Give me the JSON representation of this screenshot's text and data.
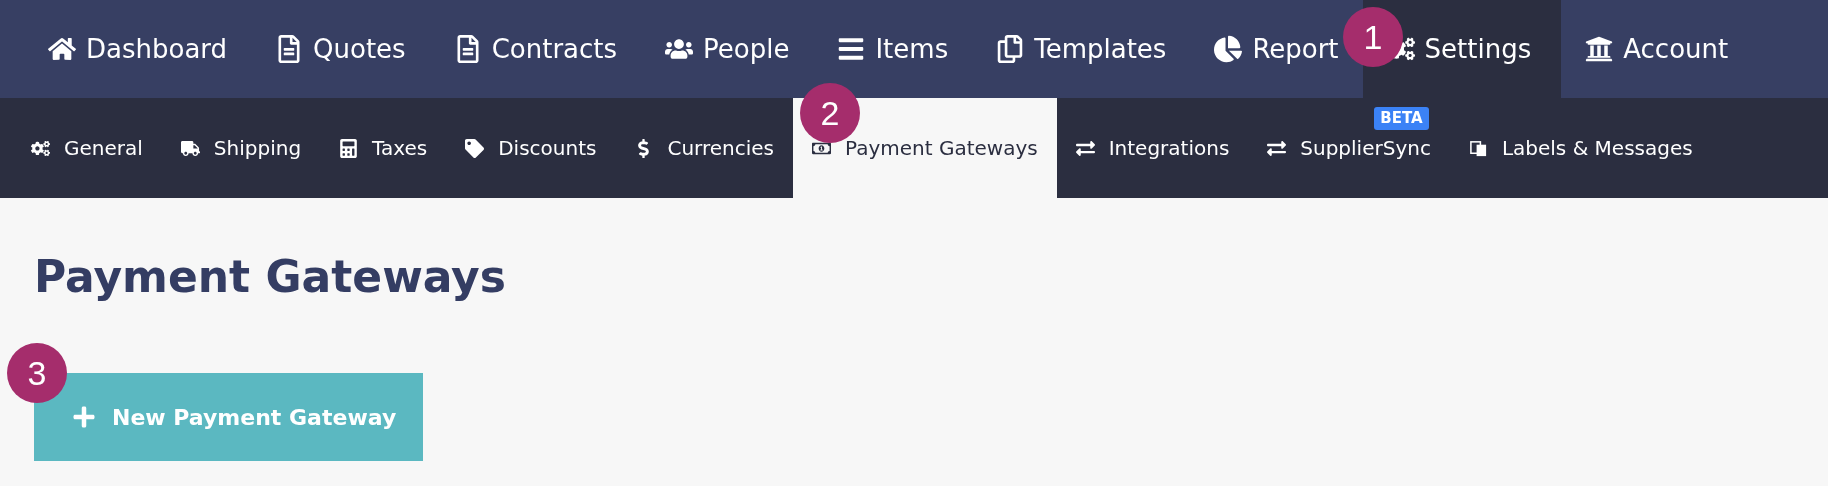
{
  "main_nav": [
    {
      "label": "Dashboard",
      "selected": false
    },
    {
      "label": "Quotes",
      "selected": false
    },
    {
      "label": "Contracts",
      "selected": false
    },
    {
      "label": "People",
      "selected": false
    },
    {
      "label": "Items",
      "selected": false
    },
    {
      "label": "Templates",
      "selected": false
    },
    {
      "label": "Report",
      "selected": false
    },
    {
      "label": "Settings",
      "selected": true
    },
    {
      "label": "Account",
      "selected": false
    }
  ],
  "settings_nav": [
    {
      "label": "General",
      "selected": false
    },
    {
      "label": "Shipping",
      "selected": false
    },
    {
      "label": "Taxes",
      "selected": false
    },
    {
      "label": "Discounts",
      "selected": false
    },
    {
      "label": "Currencies",
      "selected": false
    },
    {
      "label": "Payment Gateways",
      "selected": true
    },
    {
      "label": "Integrations",
      "selected": false
    },
    {
      "label": "SupplierSync",
      "selected": false,
      "badge": "BETA"
    },
    {
      "label": "Labels & Messages",
      "selected": false
    }
  ],
  "page": {
    "title": "Payment Gateways",
    "new_button": "New Payment Gateway"
  },
  "callouts": [
    "1",
    "2",
    "3"
  ]
}
